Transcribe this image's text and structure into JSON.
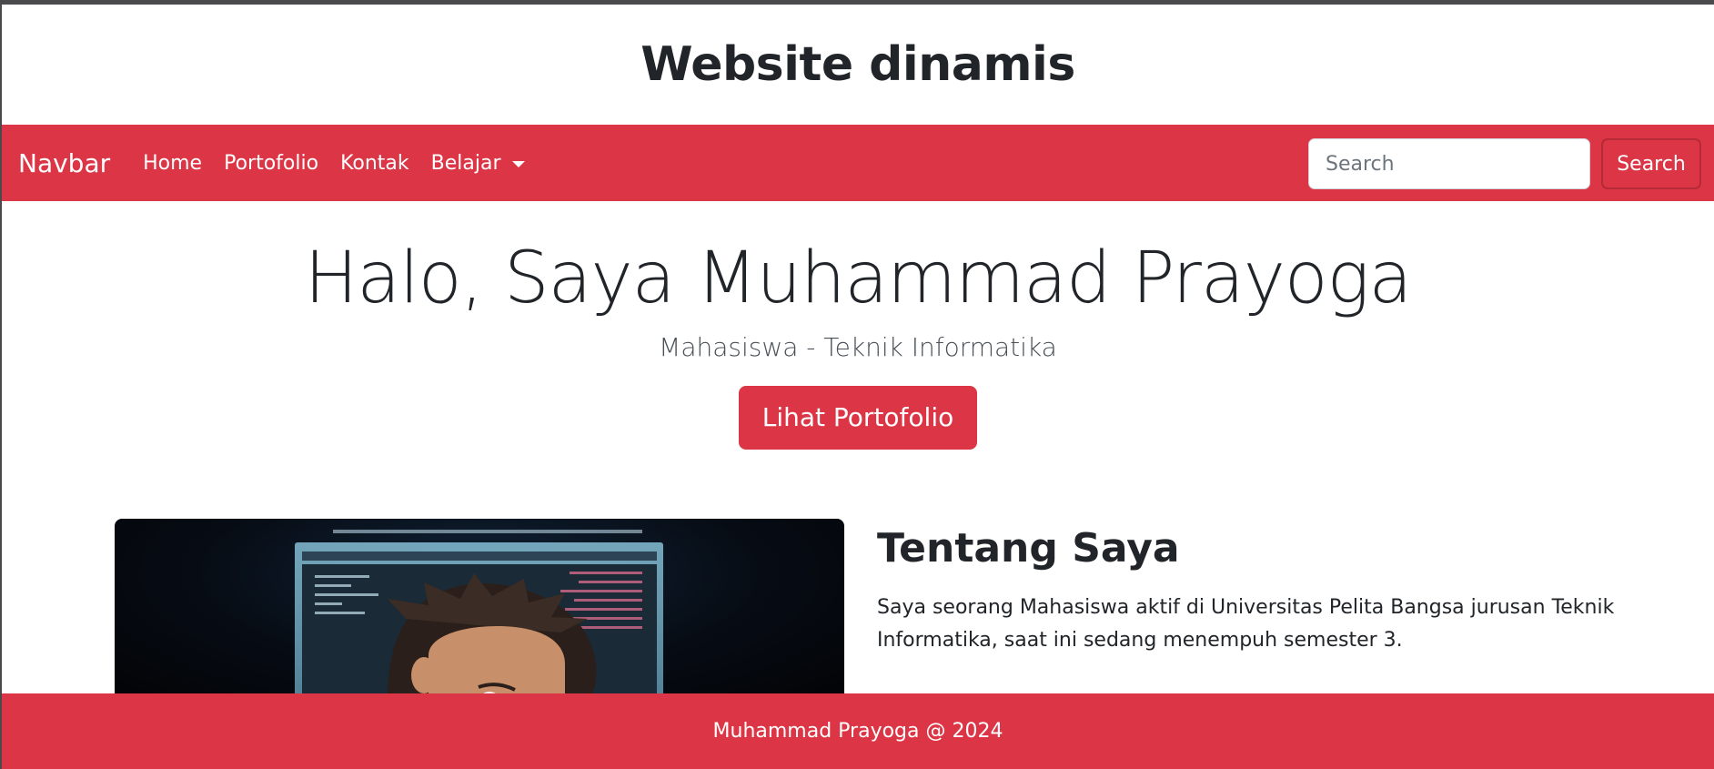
{
  "header": {
    "title": "Website dinamis"
  },
  "navbar": {
    "brand": "Navbar",
    "links": [
      {
        "label": "Home"
      },
      {
        "label": "Portofolio"
      },
      {
        "label": "Kontak"
      },
      {
        "label": "Belajar"
      }
    ],
    "search_placeholder": "Search",
    "search_button": "Search"
  },
  "hero": {
    "title": "Halo, Saya Muhammad Prayoga",
    "subtitle": "Mahasiswa - Teknik Informatika",
    "button": "Lihat Portofolio"
  },
  "about": {
    "title": "Tentang Saya",
    "description": "Saya seorang Mahasiswa aktif di Universitas Pelita Bangsa jurusan Teknik Informatika, saat ini sedang menempuh semester 3."
  },
  "footer": {
    "text": "Muhammad Prayoga @ 2024"
  },
  "colors": {
    "brand": "#dc3545",
    "text": "#212529",
    "background": "#ffffff"
  }
}
